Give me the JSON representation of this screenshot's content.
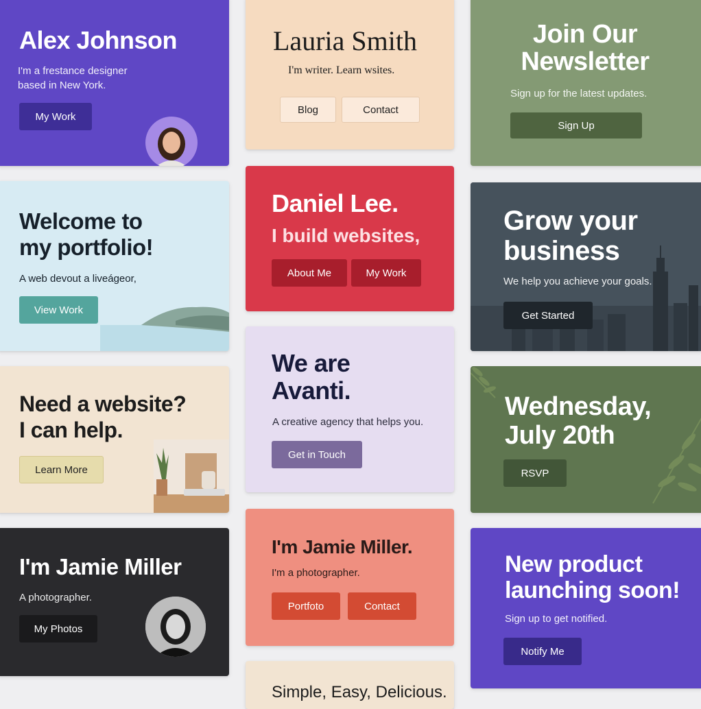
{
  "cards": {
    "alex": {
      "name": "Alex Johnson",
      "bio_line1": "I'm a frestance designer",
      "bio_line2": "based in New York.",
      "button": "My Work",
      "accent": "#5f47c5"
    },
    "lauria": {
      "name": "Lauria Smith",
      "tagline": "I'm writer. Learn wsites.",
      "buttons": [
        "Blog",
        "Contact"
      ]
    },
    "newsletter": {
      "title_line1": "Join Our",
      "title_line2": "Newsletter",
      "subtitle": "Sign up for the latest updates.",
      "button": "Sign Up"
    },
    "welcome": {
      "title_line1": "Welcome to",
      "title_line2": "my portfolio!",
      "subtitle": "A web devout a liveágeor,",
      "button": "View Work"
    },
    "daniel": {
      "name": "Daniel Lee.",
      "tagline": "I build websites,",
      "buttons": [
        "About Me",
        "My Work"
      ],
      "accent": "#d9394a"
    },
    "grow": {
      "title_line1": "Grow your",
      "title_line2": "business",
      "subtitle": "We help you achieve your goals.",
      "button": "Get Started"
    },
    "need": {
      "title_line1": "Need a website?",
      "title_line2": "I can help.",
      "button": "Learn More"
    },
    "avanti": {
      "title_line1": "We are",
      "title_line2": "Avanti.",
      "subtitle": "A creative agency that helps you.",
      "button": "Get in Touch"
    },
    "wednesday": {
      "title_line1": "Wednesday,",
      "title_line2": "July 20th",
      "button": "RSVP"
    },
    "jamie_dark": {
      "name": "I'm Jamie Miller",
      "subtitle": "A photographer.",
      "button": "My Photos"
    },
    "jamie_salmon": {
      "name": "I'm Jamie Miller.",
      "subtitle": "I'm a photographer.",
      "buttons": [
        "Portfoto",
        "Contact"
      ]
    },
    "product": {
      "title_line1": "New product",
      "title_line2": "launching soon!",
      "subtitle": "Sign up to get notified.",
      "button": "Notify Me"
    },
    "simple": {
      "title": "Simple, Easy, Delicious."
    }
  }
}
